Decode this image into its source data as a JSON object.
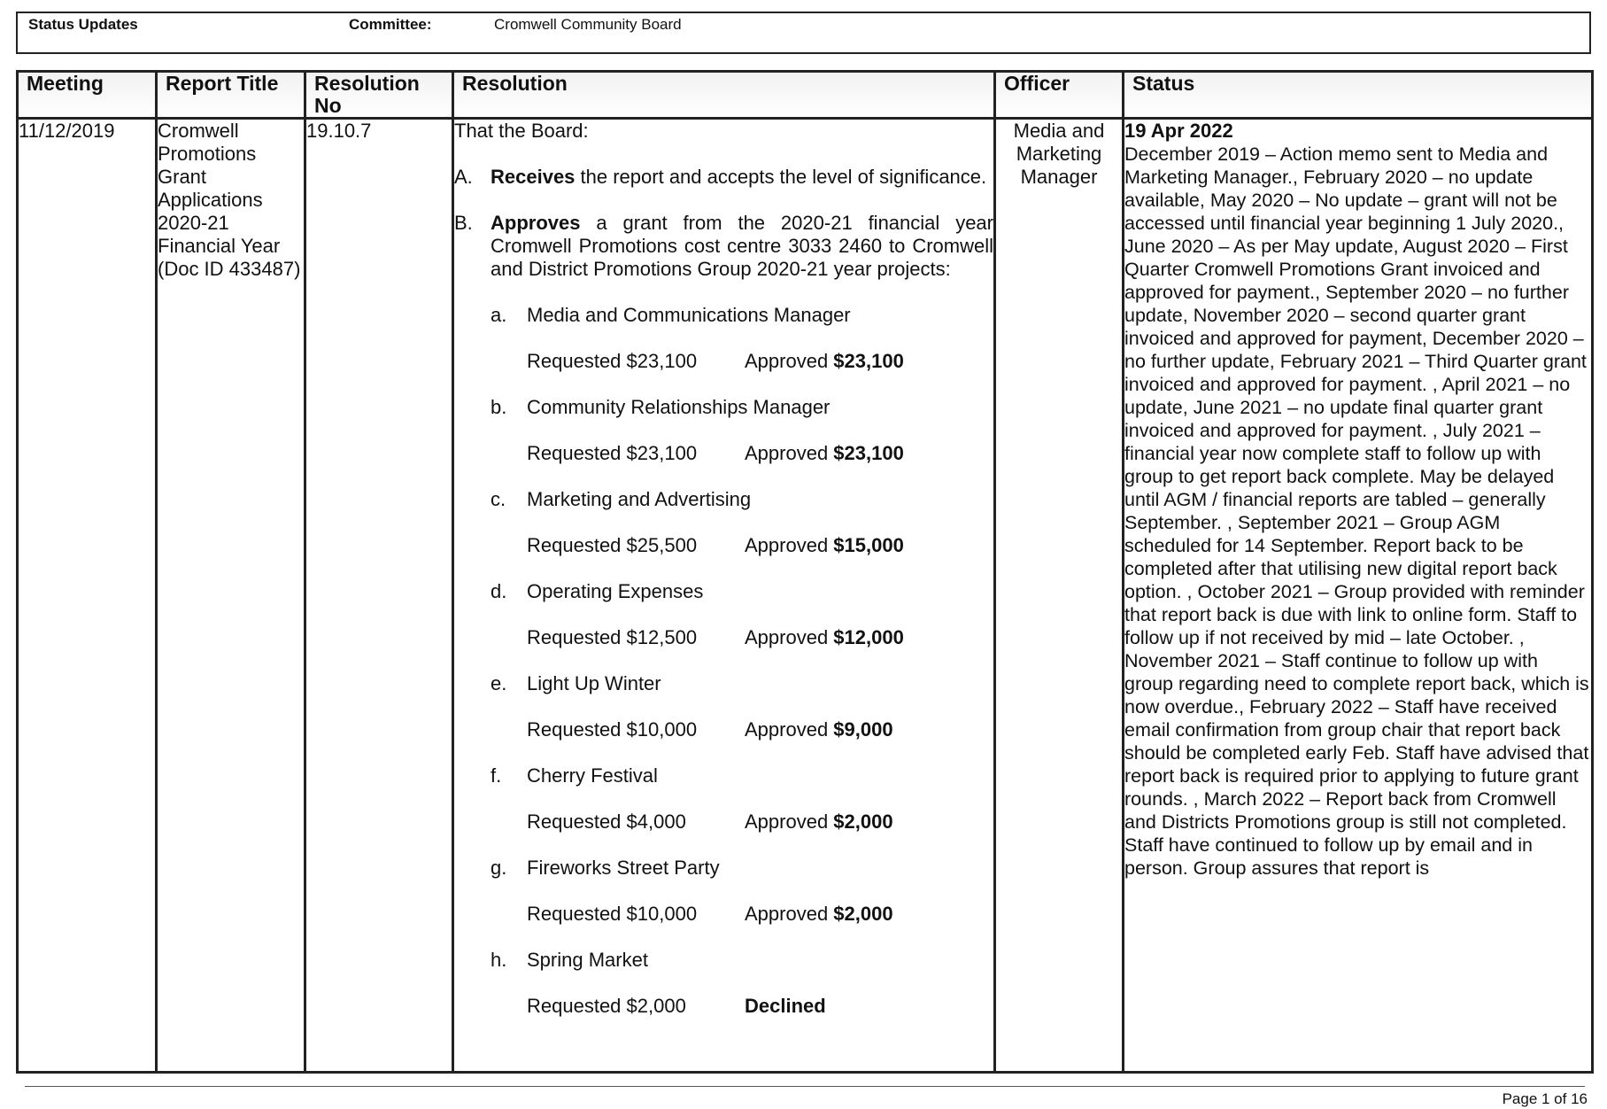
{
  "header": {
    "status_label": "Status Updates",
    "committee_label": "Committee:",
    "committee_value": "Cromwell Community Board"
  },
  "columns": [
    "Meeting",
    "Report Title",
    "Resolution No",
    "Resolution",
    "Officer",
    "Status"
  ],
  "row": {
    "meeting": "11/12/2019",
    "report_title": "Cromwell Promotions Grant Applications 2020-21 Financial Year (Doc ID 433487)",
    "resolution_no": "19.10.7",
    "resolution": {
      "intro": "That the Board:",
      "a_letter": "A.",
      "a_bold": "Receives",
      "a_text": " the report and accepts the level of significance.",
      "b_letter": "B.",
      "b_bold": "Approves",
      "b_text": " a grant from the 2020-21 financial year Cromwell Promotions cost centre 3033 2460 to Cromwell and District Promotions Group 2020-21 year projects:",
      "items": [
        {
          "letter": "a.",
          "name": "Media and Communications Manager",
          "requested": "Requested $23,100",
          "approved_label": "Approved ",
          "approved_value": "$23,100"
        },
        {
          "letter": "b.",
          "name": "Community Relationships Manager",
          "requested": "Requested $23,100",
          "approved_label": "Approved ",
          "approved_value": "$23,100"
        },
        {
          "letter": "c.",
          "name": "Marketing and Advertising",
          "requested": "Requested $25,500",
          "approved_label": "Approved ",
          "approved_value": "$15,000"
        },
        {
          "letter": "d.",
          "name": "Operating Expenses",
          "requested": "Requested $12,500",
          "approved_label": "Approved ",
          "approved_value": "$12,000"
        },
        {
          "letter": "e.",
          "name": "Light Up Winter",
          "requested": "Requested $10,000",
          "approved_label": "Approved ",
          "approved_value": "$9,000"
        },
        {
          "letter": "f.",
          "name": "Cherry Festival",
          "requested": "Requested $4,000",
          "approved_label": "Approved ",
          "approved_value": "$2,000"
        },
        {
          "letter": "g.",
          "name": "Fireworks Street Party",
          "requested": "Requested $10,000",
          "approved_label": "Approved ",
          "approved_value": "$2,000"
        },
        {
          "letter": "h.",
          "name": "Spring Market",
          "requested": "Requested $2,000",
          "approved_label": "",
          "approved_value": "Declined"
        }
      ]
    },
    "officer": "Media and Marketing Manager",
    "status_date": "19 Apr 2022",
    "status_text": "December 2019 – Action memo sent to Media and Marketing Manager., February 2020 – no update available, May 2020 – No update – grant will not be accessed until financial year beginning 1 July 2020., June 2020 – As per May update, August 2020 – First Quarter Cromwell Promotions Grant invoiced and approved for payment., September 2020 – no further update, November 2020 – second quarter grant invoiced and approved for payment, December 2020 – no further update, February 2021 – Third Quarter grant invoiced and approved for payment. , April 2021 – no update, June 2021 – no update final quarter grant invoiced and approved for payment.  , July 2021 – financial year now complete staff to follow up with group to get report back complete. May be delayed until AGM / financial reports are tabled – generally September. , September 2021 – Group AGM scheduled for 14 September. Report back to be completed after that utilising new digital report back option. , October 2021 – Group provided with reminder that report back is due with link to online form. Staff to follow up if not received by mid – late October. , November 2021 – Staff continue to follow up with group regarding need to complete report back, which is now overdue., February 2022 – Staff have received email confirmation from group chair that report back should be completed early Feb. Staff have advised that report back is required prior to applying to future grant rounds. , March 2022 – Report back from Cromwell and Districts Promotions group is still not completed. Staff have continued to follow up by email and in person. Group assures that report is"
  },
  "footer": {
    "page": "Page 1 of 16"
  }
}
